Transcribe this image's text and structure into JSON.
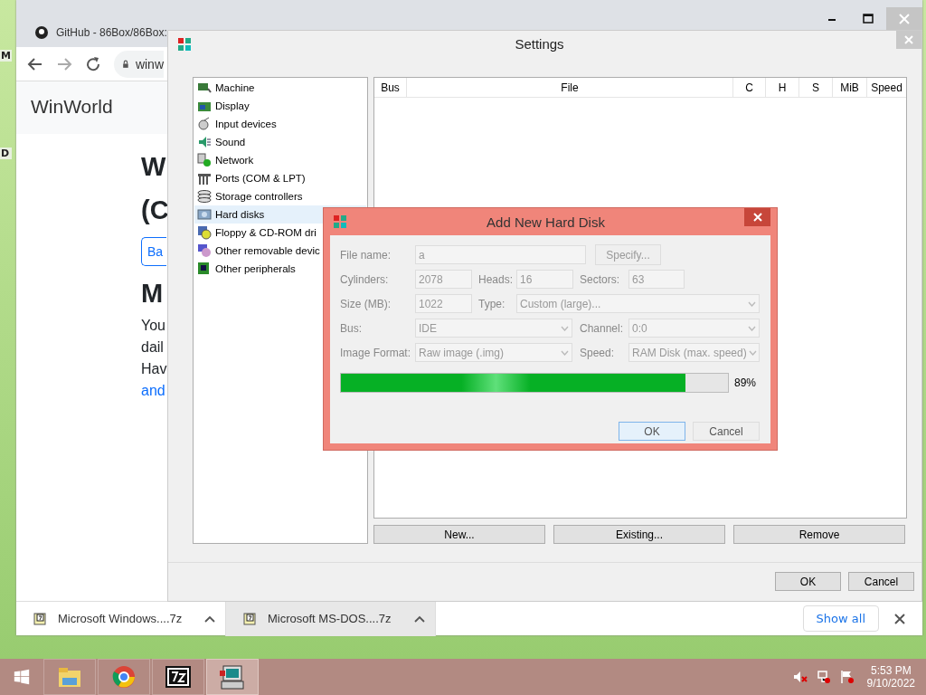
{
  "desktop_icons": [
    {
      "label": "M"
    },
    {
      "label": "D"
    }
  ],
  "browser": {
    "tabs": [
      {
        "title": "GitHub - 86Box/86Box:",
        "selected": false
      }
    ],
    "address": "winw",
    "site_title": "WinWorld",
    "page_lines": [
      {
        "kind": "heading",
        "text": "W"
      },
      {
        "kind": "heading",
        "text": "(C"
      },
      {
        "kind": "button",
        "text": "Ba"
      },
      {
        "kind": "heading",
        "text": "M"
      },
      {
        "kind": "text",
        "text": "You"
      },
      {
        "kind": "text",
        "text": "dail"
      },
      {
        "kind": "para",
        "text": "Hav"
      },
      {
        "kind": "link",
        "text": "and"
      }
    ],
    "downloads": [
      {
        "name": "Microsoft Windows....7z",
        "highlighted": false
      },
      {
        "name": "Microsoft MS-DOS....7z",
        "highlighted": true
      }
    ],
    "show_all": "Show all"
  },
  "settings": {
    "title": "Settings",
    "categories": [
      {
        "label": "Machine",
        "selected": false
      },
      {
        "label": "Display",
        "selected": false
      },
      {
        "label": "Input devices",
        "selected": false
      },
      {
        "label": "Sound",
        "selected": false
      },
      {
        "label": "Network",
        "selected": false
      },
      {
        "label": "Ports (COM & LPT)",
        "selected": false
      },
      {
        "label": "Storage controllers",
        "selected": false
      },
      {
        "label": "Hard disks",
        "selected": true
      },
      {
        "label": "Floppy & CD-ROM dri",
        "selected": false
      },
      {
        "label": "Other removable devic",
        "selected": false
      },
      {
        "label": "Other peripherals",
        "selected": false
      }
    ],
    "columns": [
      "Bus",
      "File",
      "C",
      "H",
      "S",
      "MiB",
      "Speed"
    ],
    "disk_buttons": [
      "New...",
      "Existing...",
      "Remove"
    ],
    "buttons": [
      "OK",
      "Cancel"
    ]
  },
  "dialog": {
    "title": "Add New Hard Disk",
    "rows": [
      [
        {
          "kind": "text",
          "label": "File name:",
          "value": "a",
          "disabled": true
        },
        {
          "kind": "button",
          "label": "Specify...",
          "disabled": true
        }
      ],
      [
        {
          "kind": "text",
          "label": "Cylinders:",
          "value": "2078",
          "disabled": true
        },
        {
          "kind": "text",
          "label": "Heads:",
          "value": "16",
          "disabled": true
        },
        {
          "kind": "text",
          "label": "Sectors:",
          "value": "63",
          "disabled": true
        }
      ],
      [
        {
          "kind": "text",
          "label": "Size (MB):",
          "value": "1022",
          "disabled": true
        },
        {
          "kind": "select",
          "label": "Type:",
          "value": "Custom (large)...",
          "disabled": true
        }
      ],
      [
        {
          "kind": "select",
          "label": "Bus:",
          "value": "IDE",
          "disabled": true
        },
        {
          "kind": "select",
          "label": "Channel:",
          "value": "0:0",
          "disabled": true
        }
      ],
      [
        {
          "kind": "select",
          "label": "Image Format:",
          "value": "Raw image (.img)",
          "disabled": true
        },
        {
          "kind": "select",
          "label": "Speed:",
          "value": "RAM Disk (max. speed)",
          "disabled": true
        }
      ]
    ],
    "progress": {
      "level": 0.89,
      "reading": "89%"
    },
    "buttons": [
      {
        "label": "OK",
        "default": true
      },
      {
        "label": "Cancel",
        "default": false
      }
    ]
  },
  "taskbar": {
    "apps": [
      {
        "selected": false
      },
      {
        "selected": false
      },
      {
        "selected": false
      },
      {
        "selected": true
      }
    ],
    "time": "5:53 PM",
    "date": "9/10/2022"
  }
}
